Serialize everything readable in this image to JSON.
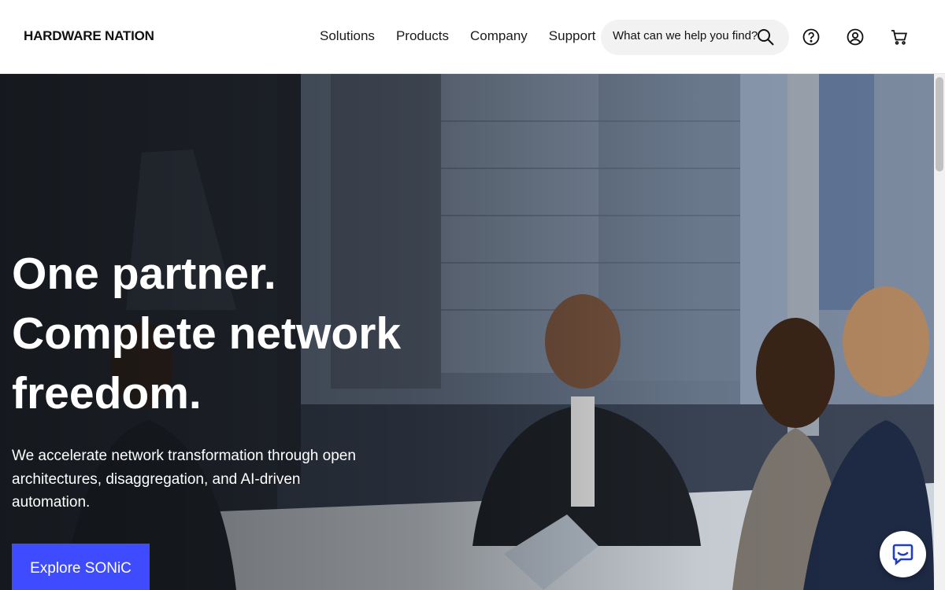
{
  "header": {
    "logo": "HARDWARE NATION",
    "nav": [
      "Solutions",
      "Products",
      "Company",
      "Support"
    ],
    "search_placeholder": "What can we help you find?",
    "icons": [
      "search-icon",
      "help-icon",
      "account-icon",
      "cart-icon"
    ]
  },
  "hero": {
    "title_lines": [
      "One partner.",
      "Complete network",
      "freedom."
    ],
    "subtitle": "We accelerate network transformation through open architectures, disaggregation, and AI-driven automation.",
    "cta_label": "Explore SONiC"
  },
  "chat": {
    "icon": "chat-icon"
  },
  "colors": {
    "accent": "#3e4bff",
    "text": "#111111",
    "hero_text": "#ffffff"
  }
}
